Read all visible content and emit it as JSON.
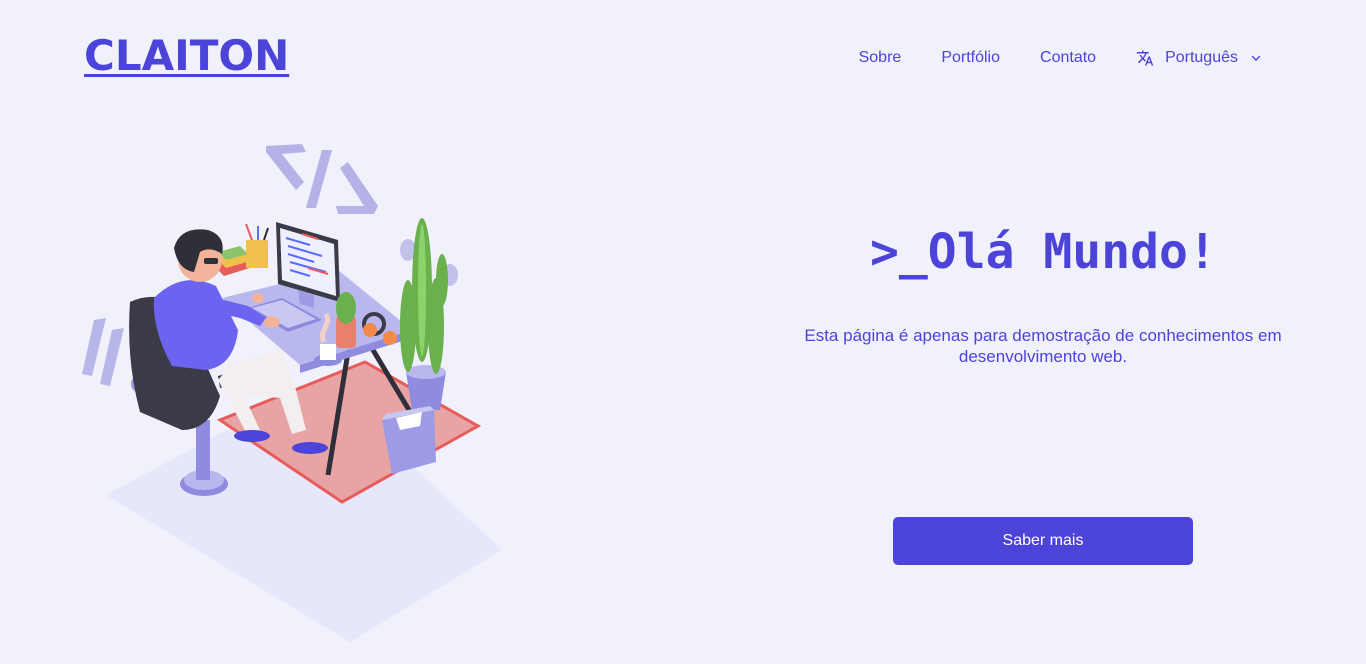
{
  "header": {
    "logo": "CLAITON",
    "nav": {
      "about": "Sobre",
      "portfolio": "Portfólio",
      "contact": "Contato"
    },
    "language": {
      "icon": "translate-icon",
      "selected": "Português",
      "chevron": "chevron-down-icon"
    }
  },
  "hero": {
    "title": ">_Olá Mundo!",
    "description": "Esta página é apenas para demostração de conhecimentos em desenvolvimento web.",
    "cta_label": "Saber mais",
    "illustration": "developer-at-desk-illustration"
  },
  "colors": {
    "background": "#f1f1fc",
    "accent": "#4c44d9",
    "button_text": "#ffffff"
  }
}
